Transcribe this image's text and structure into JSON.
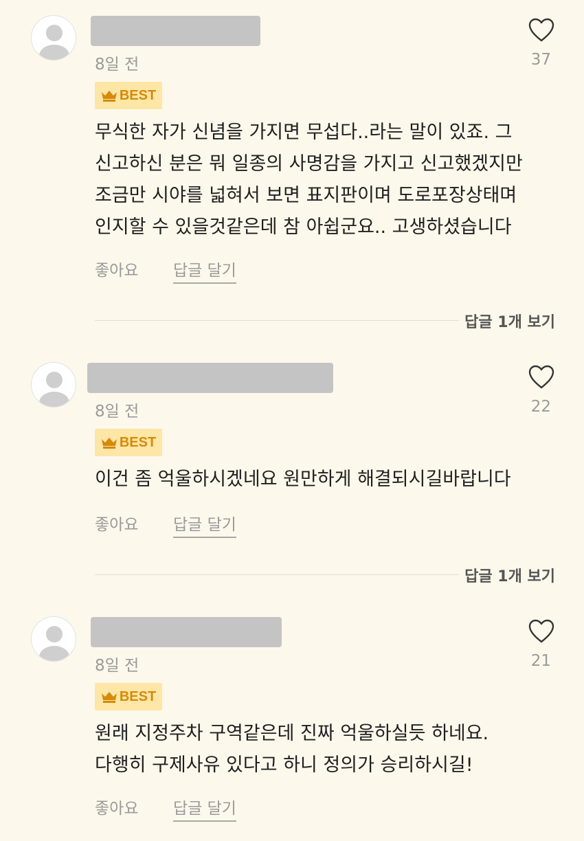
{
  "comments": [
    {
      "date": "8일 전",
      "like_count": "37",
      "badge": "BEST",
      "body_lines": [
        "무식한 자가 신념을 가지면 무섭다..라는 말이 있죠. 그",
        "신고하신 분은 뭐 일종의 사명감을 가지고 신고했겠지만",
        "조금만 시야를 넓혀서 보면 표지판이며 도로포장상태며",
        "인지할 수 있을것같은데 참 아쉽군요.. 고생하셨습니다"
      ],
      "like_label": "좋아요",
      "reply_label": "답글 달기",
      "view_replies_label": "답글 1개 보기"
    },
    {
      "date": "8일 전",
      "like_count": "22",
      "badge": "BEST",
      "body_lines": [
        "이건 좀 억울하시겠네요 원만하게 해결되시길바랍니다"
      ],
      "like_label": "좋아요",
      "reply_label": "답글 달기",
      "view_replies_label": "답글 1개 보기"
    },
    {
      "date": "8일 전",
      "like_count": "21",
      "badge": "BEST",
      "body_lines": [
        "원래 지정주차 구역같은데 진짜 억울하실듯 하네요.",
        "다행히 구제사유 있다고 하니 정의가 승리하시길!"
      ],
      "like_label": "좋아요",
      "reply_label": "답글 달기"
    }
  ],
  "icons": {
    "avatar": "default-user-avatar-icon",
    "like": "heart-outline-icon",
    "badge": "crown-icon"
  },
  "colors": {
    "background": "#fdf8ec",
    "badge_bg": "#fde6a6",
    "badge_text": "#d58a0a",
    "muted_text": "#9a9a9a"
  }
}
